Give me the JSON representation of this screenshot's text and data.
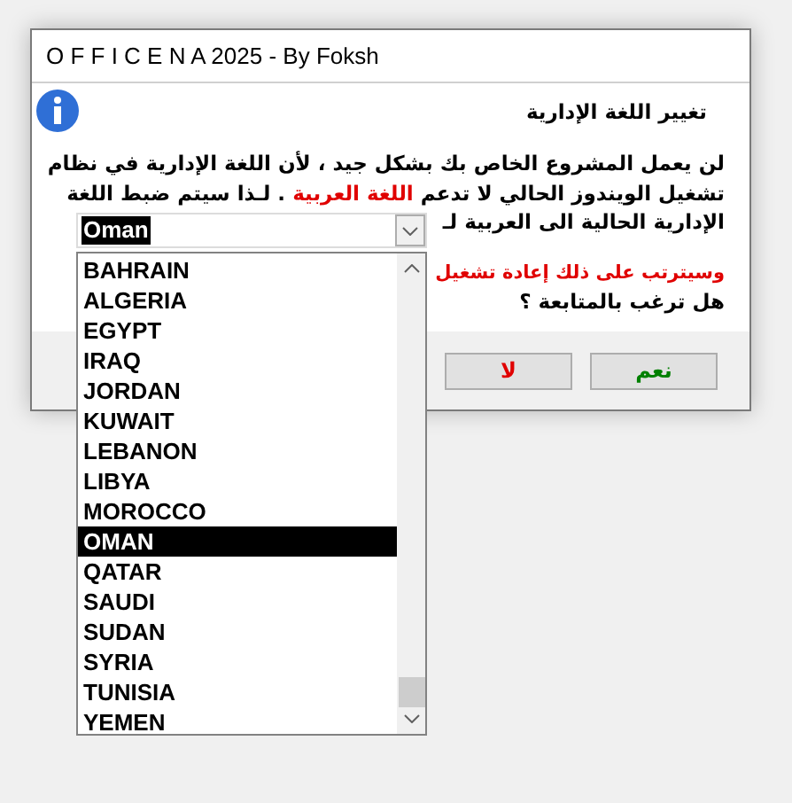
{
  "window": {
    "title": "O F F I C E N A 2025 - By Foksh"
  },
  "heading": "تغيير اللغة الإدارية",
  "message_lines": [
    {
      "parts": [
        {
          "text": "لن يعمل المشروع الخاص بك بشكل جيد ، لأن اللغة الإدارية في نظام",
          "highlight": false
        }
      ]
    },
    {
      "parts": [
        {
          "text": "تشغيل الويندوز الحالي لا تدعم ",
          "highlight": false
        },
        {
          "text": "اللغة العربية",
          "highlight": true
        },
        {
          "text": " . لـذا سيتم ضبط اللغة",
          "highlight": false
        }
      ]
    },
    {
      "parts": [
        {
          "text": "الإدارية الحالية الى العربية لـ",
          "highlight": false
        }
      ]
    }
  ],
  "warning": "وسيترتب على ذلك إعادة تشغيل",
  "question": "هل ترغب بالمتابعة ؟",
  "combobox": {
    "value": "Oman"
  },
  "country_list": [
    {
      "label": "BAHRAIN",
      "selected": false
    },
    {
      "label": "ALGERIA",
      "selected": false
    },
    {
      "label": "EGYPT",
      "selected": false
    },
    {
      "label": "IRAQ",
      "selected": false
    },
    {
      "label": "JORDAN",
      "selected": false
    },
    {
      "label": "KUWAIT",
      "selected": false
    },
    {
      "label": "LEBANON",
      "selected": false
    },
    {
      "label": "LIBYA",
      "selected": false
    },
    {
      "label": "MOROCCO",
      "selected": false
    },
    {
      "label": "OMAN",
      "selected": true
    },
    {
      "label": "QATAR",
      "selected": false
    },
    {
      "label": "SAUDI",
      "selected": false
    },
    {
      "label": "SUDAN",
      "selected": false
    },
    {
      "label": "SYRIA",
      "selected": false
    },
    {
      "label": "TUNISIA",
      "selected": false
    },
    {
      "label": "YEMEN",
      "selected": false
    }
  ],
  "buttons": [
    {
      "label": "نعم",
      "kind": "ok"
    },
    {
      "label": "لا",
      "kind": "cancel"
    }
  ]
}
